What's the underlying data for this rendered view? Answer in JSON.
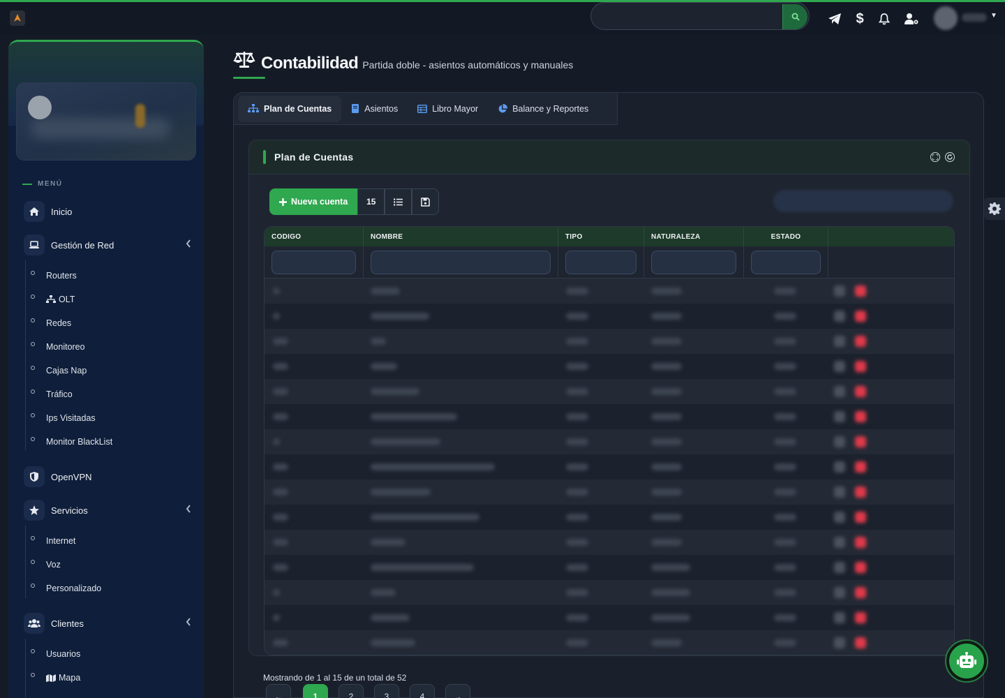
{
  "colors": {
    "accent": "#2fa84f",
    "sidebar_bg": "#0f1e3a",
    "page_bg": "#151b26",
    "danger": "#e0394a"
  },
  "navbar": {
    "search_placeholder": "",
    "icons": [
      "telegram-icon",
      "dollar-icon",
      "bell-icon",
      "user-cog-icon"
    ]
  },
  "sidebar": {
    "menu_heading": "MENÚ",
    "items": {
      "inicio": "Inicio",
      "gestion_red": "Gestión de Red",
      "routers": "Routers",
      "olt": "OLT",
      "redes": "Redes",
      "monitoreo": "Monitoreo",
      "cajas_nap": "Cajas Nap",
      "trafico": "Tráfico",
      "ips_visitadas": "Ips Visitadas",
      "monitor_blacklist": "Monitor BlackList",
      "openvpn": "OpenVPN",
      "servicios": "Servicios",
      "internet": "Internet",
      "voz": "Voz",
      "personalizado": "Personalizado",
      "clientes": "Clientes",
      "usuarios": "Usuarios",
      "mapa": "Mapa"
    }
  },
  "page": {
    "title": "Contabilidad",
    "subtitle": "Partida doble - asientos automáticos y manuales"
  },
  "tabs": {
    "plan": "Plan de Cuentas",
    "asientos": "Asientos",
    "libro": "Libro Mayor",
    "balance": "Balance y Reportes"
  },
  "card": {
    "title": "Plan de Cuentas",
    "new_button": "Nueva cuenta",
    "page_length": "15"
  },
  "table": {
    "columns": {
      "codigo": "CODIGO",
      "nombre": "NOMBRE",
      "tipo": "TIPO",
      "naturaleza": "NATURALEZA",
      "estado": "ESTADO"
    },
    "row_count": 15
  },
  "pagination": {
    "info": "Mostrando de 1 al 15 de un total de 52",
    "prev": "←",
    "next": "→",
    "pages": [
      "1",
      "2",
      "3",
      "4"
    ],
    "current": "1"
  }
}
